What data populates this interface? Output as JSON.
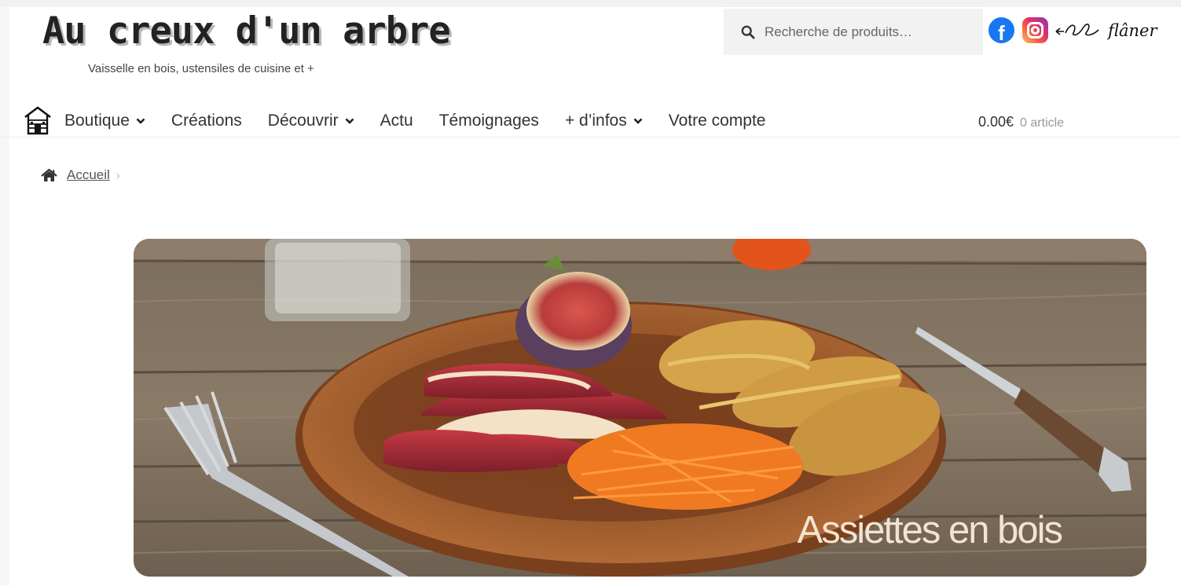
{
  "brand": {
    "title": "Au creux d'un arbre",
    "tagline": "Vaisselle en bois, ustensiles de cuisine et +"
  },
  "search": {
    "placeholder": "Recherche de produits…",
    "icon": "search-icon"
  },
  "social": {
    "facebook_glyph": "f",
    "signature_text": "flâner"
  },
  "nav": {
    "home_icon": "house-icon",
    "items": [
      {
        "label": "Boutique",
        "dropdown": true
      },
      {
        "label": "Créations",
        "dropdown": false
      },
      {
        "label": "Découvrir",
        "dropdown": true
      },
      {
        "label": "Actu",
        "dropdown": false
      },
      {
        "label": "Témoignages",
        "dropdown": false
      },
      {
        "label": "+ d’infos",
        "dropdown": true
      },
      {
        "label": "Votre compte",
        "dropdown": false
      }
    ]
  },
  "cart": {
    "amount": "0.00€",
    "count": "0 article"
  },
  "breadcrumb": {
    "home_label": "Accueil",
    "separator": "›"
  },
  "hero": {
    "caption": "Assiettes en bois"
  },
  "colors": {
    "facebook": "#1877f2",
    "search_bg": "#f2f2f2",
    "caption": "#f3e3cf"
  }
}
